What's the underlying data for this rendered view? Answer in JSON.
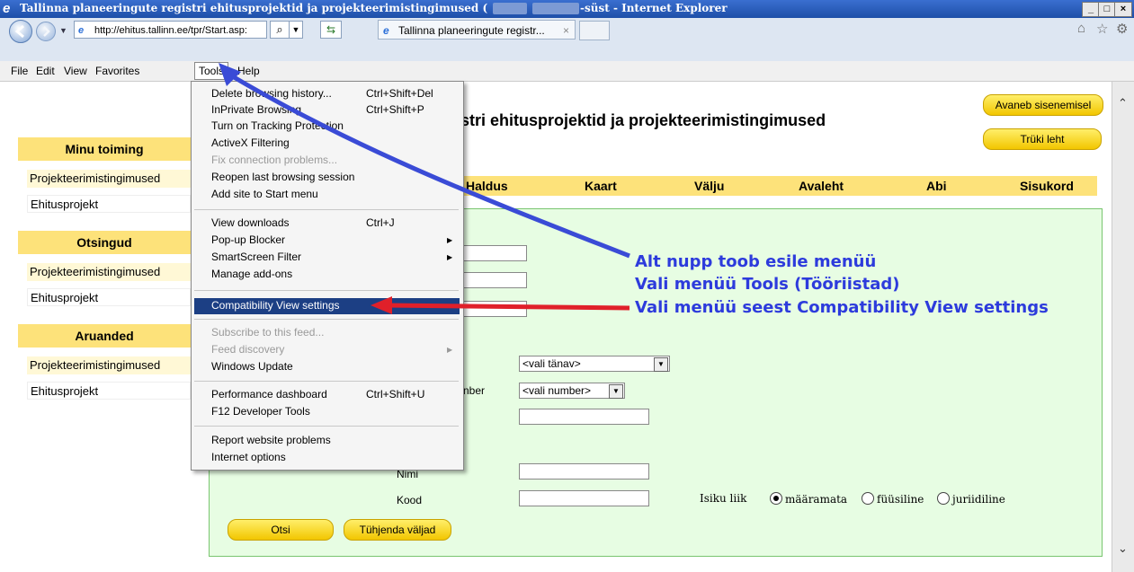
{
  "window": {
    "title_start": "Tallinna planeeringute registri ehitusprojektid ja projekteerimistingimused (",
    "title_end": "-süst - Internet Explorer",
    "controls": [
      "_",
      "□",
      "×"
    ]
  },
  "browser": {
    "address": "http://ehitus.tallinn.ee/tpr/Start.asp:",
    "tab_label": "Tallinna planeeringute registr...",
    "tab_close": "×",
    "search_glyph": "⌕"
  },
  "menubar": {
    "items": [
      "File",
      "Edit",
      "View",
      "Favorites",
      "Tools",
      "Help"
    ]
  },
  "tools_menu": {
    "items": [
      {
        "label": "Delete browsing history...",
        "shortcut": "Ctrl+Shift+Del"
      },
      {
        "label": "InPrivate Browsing",
        "shortcut": "Ctrl+Shift+P"
      },
      {
        "label": "Turn on Tracking Protection",
        "shortcut": ""
      },
      {
        "label": "ActiveX Filtering",
        "shortcut": ""
      },
      {
        "label": "Fix connection problems...",
        "shortcut": ""
      },
      {
        "label": "Reopen last browsing session",
        "shortcut": ""
      },
      {
        "label": "Add site to Start menu",
        "shortcut": ""
      },
      {
        "label": "View downloads",
        "shortcut": "Ctrl+J"
      },
      {
        "label": "Pop-up Blocker",
        "shortcut": ""
      },
      {
        "label": "SmartScreen Filter",
        "shortcut": ""
      },
      {
        "label": "Manage add-ons",
        "shortcut": ""
      },
      {
        "label": "Compatibility View settings",
        "shortcut": ""
      },
      {
        "label": "Subscribe to this feed...",
        "shortcut": ""
      },
      {
        "label": "Feed discovery",
        "shortcut": ""
      },
      {
        "label": "Windows Update",
        "shortcut": ""
      },
      {
        "label": "Performance dashboard",
        "shortcut": "Ctrl+Shift+U"
      },
      {
        "label": "F12 Developer Tools",
        "shortcut": ""
      },
      {
        "label": "Report website problems",
        "shortcut": ""
      },
      {
        "label": "Internet options",
        "shortcut": ""
      }
    ]
  },
  "page": {
    "title_partial": "stri ehitusprojektid ja projekteerimistingimused",
    "btn_open": "Avaneb sisenemisel",
    "btn_print": "Trüki leht",
    "sidebar": {
      "sections": [
        {
          "heading": "Minu toiming",
          "items": [
            "Projekteerimistingimused",
            "Ehitusprojekt"
          ]
        },
        {
          "heading": "Otsingud",
          "items": [
            "Projekteerimistingimused",
            "Ehitusprojekt"
          ]
        },
        {
          "heading": "Aruanded",
          "items": [
            "Projekteerimistingimused",
            "Ehitusprojekt"
          ]
        }
      ]
    },
    "nav": [
      "Haldus",
      "Kaart",
      "Välju",
      "Avaleht",
      "Abi",
      "Sisukord"
    ],
    "form": {
      "street_select": "<vali tänav>",
      "number_label_partial": "nber",
      "number_select": "<vali number>",
      "name_label": "Nimi",
      "code_label": "Kood",
      "person_type_label": "Isiku liik",
      "radios": [
        "määramata",
        "füüsiline",
        "juriidiline"
      ],
      "search_button": "Otsi",
      "clear_button": "Tühjenda väljad"
    }
  },
  "annotations": {
    "line1": "Alt nupp toob esile menüü",
    "line2": "Vali menüü Tools (Tööriistad)",
    "line3": "Vali menüü seest Compatibility View settings",
    "arrow_blue": "#3a4bd6",
    "arrow_red": "#e0202a"
  },
  "icons": [
    "ie-logo-icon",
    "back-arrow-icon",
    "forward-arrow-icon",
    "home-icon",
    "star-icon",
    "gear-icon",
    "refresh-icon"
  ]
}
